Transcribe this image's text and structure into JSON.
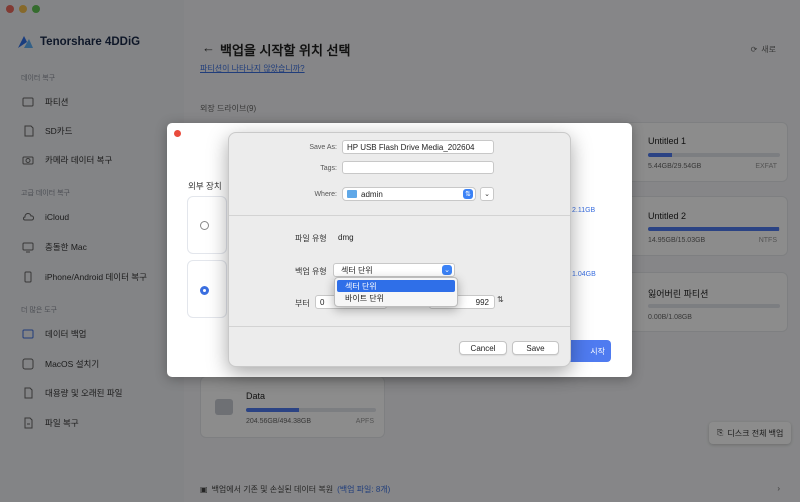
{
  "app": {
    "brand": "Tenorshare 4DDiG",
    "colors": {
      "accent": "#4f7bf0",
      "link": "#3b6fe0",
      "close": "#e94b3c"
    }
  },
  "sidebar": {
    "section_recovery": "데이터 복구",
    "section_advanced": "고급 데이터 복구",
    "section_tools": "더 많은 도구",
    "items": [
      {
        "label": "파티션",
        "icon": "partition-icon"
      },
      {
        "label": "SD카드",
        "icon": "sdcard-icon"
      },
      {
        "label": "카메라 데이터 복구",
        "icon": "camera-icon"
      },
      {
        "label": "iCloud",
        "icon": "cloud-icon"
      },
      {
        "label": "충돌한 Mac",
        "icon": "mac-icon"
      },
      {
        "label": "iPhone/Android 데이터 복구",
        "icon": "phone-icon"
      },
      {
        "label": "데이터 백업",
        "icon": "backup-icon"
      },
      {
        "label": "MacOS 설치기",
        "icon": "installer-icon"
      },
      {
        "label": "대용량 및 오래된 파일",
        "icon": "file-icon"
      },
      {
        "label": "파일 복구",
        "icon": "repair-icon"
      }
    ]
  },
  "main": {
    "title": "백업을 시작할 위치 선택",
    "help_link": "파티션이 나타나지 않았습니까?",
    "refresh": "새로",
    "external_label": "외장 드라이브(9)",
    "cards": [
      {
        "name": "Untitled 1",
        "size": "5.44GB/29.54GB",
        "fs": "EXFAT",
        "usage": 0.18
      },
      {
        "name": "Untitled 2",
        "size": "14.95GB/15.03GB",
        "fs": "NTFS",
        "usage": 0.99
      },
      {
        "name": "잃어버린 파티션",
        "size": "0.00B/1.08GB",
        "fs": "",
        "usage": 0.0
      },
      {
        "name": "Data",
        "size": "204.56GB/494.38GB",
        "fs": "APFS",
        "usage": 0.41
      }
    ],
    "full_disk_backup": "디스크 전체 백업",
    "bottom_text": "백업에서 기존 및 손실된 데이터 복원",
    "bottom_highlight": "(백업 파일: 8개)"
  },
  "mid_dialog": {
    "label": "외부 장치",
    "size1": "2.11GB",
    "size2": "1.04GB",
    "start_label": "시작"
  },
  "save_sheet": {
    "save_as_label": "Save As:",
    "save_as_value": "HP USB Flash Drive Media_202604",
    "tags_label": "Tags:",
    "tags_value": "",
    "where_label": "Where:",
    "where_value": "admin",
    "file_type_label": "파일 유형",
    "file_type_value": "dmg",
    "backup_type_label": "백업 유형",
    "backup_type_value": "섹터 단위",
    "backup_type_options": [
      "섹터 단위",
      "바이트 단위"
    ],
    "from_label": "부터",
    "from_value": "0",
    "to_value": "992",
    "cancel": "Cancel",
    "save": "Save"
  }
}
